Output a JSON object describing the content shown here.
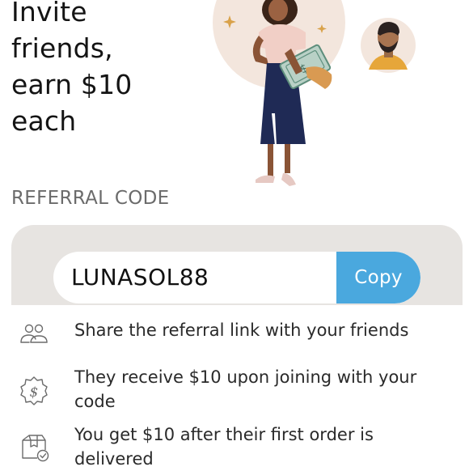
{
  "header": {
    "title_lines": [
      "Invite",
      "friends,",
      "earn $10",
      "each"
    ]
  },
  "illustration": {
    "icon": "woman-holding-cash-illustration",
    "avatar_icon": "friend-avatar-icon"
  },
  "referral": {
    "section_label": "REFERRAL CODE",
    "code": "LUNASOL88",
    "copy_label": "Copy"
  },
  "steps": [
    {
      "icon": "people-icon",
      "text": "Share the referral link with your friends"
    },
    {
      "icon": "dollar-badge-icon",
      "text": "They receive $10 upon joining with your code"
    },
    {
      "icon": "delivered-box-icon",
      "text": "You get $10 after their first order is delivered"
    }
  ],
  "colors": {
    "accent": "#4aa8de",
    "panel": "#e7e4e1",
    "illustration_circle": "#f3e6dd"
  }
}
